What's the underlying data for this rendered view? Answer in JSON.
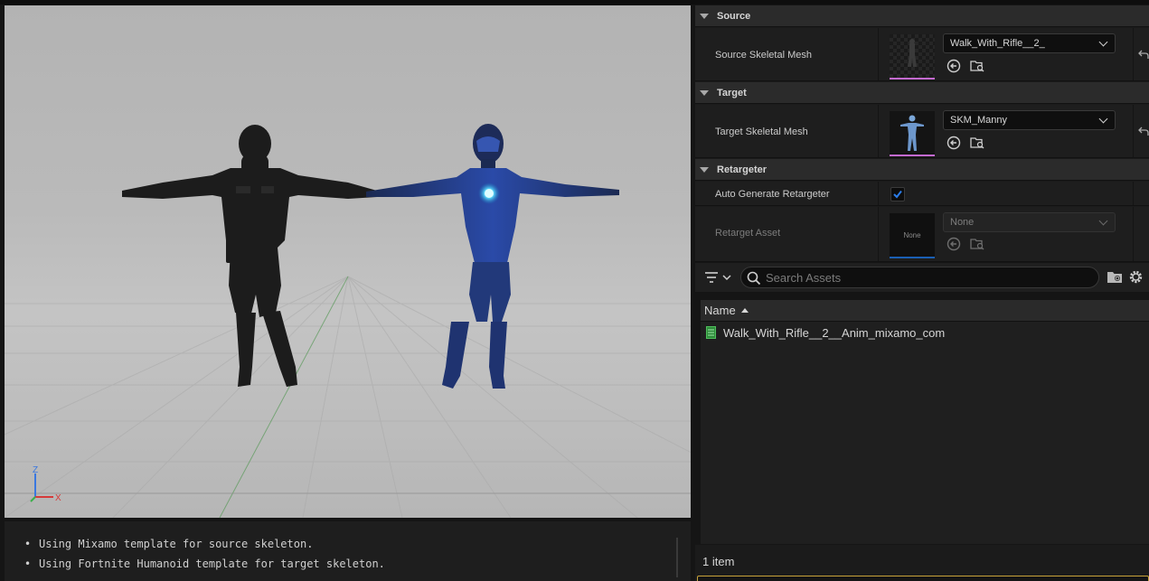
{
  "details": {
    "source": {
      "header": "Source",
      "property_label": "Source Skeletal Mesh",
      "mesh_value": "Walk_With_Rifle__2_"
    },
    "target": {
      "header": "Target",
      "property_label": "Target Skeletal Mesh",
      "mesh_value": "SKM_Manny"
    },
    "retargeter": {
      "header": "Retargeter",
      "auto_generate_label": "Auto Generate Retargeter",
      "auto_generate_checked": true,
      "asset_label": "Retarget Asset",
      "asset_thumb_text": "None",
      "asset_value": "None"
    }
  },
  "asset_browser": {
    "search_placeholder": "Search Assets",
    "column_name": "Name",
    "items": [
      {
        "name": "Walk_With_Rifle__2__Anim_mixamo_com"
      }
    ],
    "item_count": "1 item"
  },
  "log": {
    "lines": [
      "Using Mixamo template for source skeleton.",
      "Using Fortnite Humanoid template for target skeleton."
    ]
  },
  "viewport": {
    "axis_x": "X",
    "axis_z": "Z"
  },
  "colors": {
    "accent_blue": "#1a5fb4",
    "thumb_underline": "#c46ad0",
    "gizmo_x": "#d63a3a",
    "gizmo_z": "#3a78e0",
    "gizmo_y": "#3ab04a"
  }
}
